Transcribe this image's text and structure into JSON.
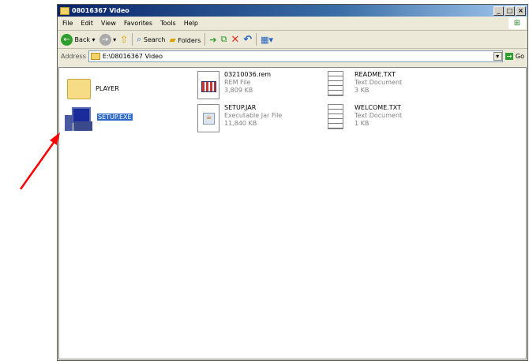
{
  "window": {
    "title": "08016367 Video",
    "controls": [
      "_",
      "□",
      "×"
    ]
  },
  "menu": [
    "File",
    "Edit",
    "View",
    "Favorites",
    "Tools",
    "Help"
  ],
  "toolbar": {
    "back": "Back",
    "search": "Search",
    "folders": "Folders"
  },
  "address": {
    "label": "Address",
    "value": "E:\\08016367 Video",
    "go": "Go"
  },
  "files": [
    {
      "name": "PLAYER"
    },
    {
      "name": "SETUP.EXE"
    },
    {
      "name": "03210036.rem",
      "type": "REM File",
      "size": "3,809 KB"
    },
    {
      "name": "SETUP.JAR",
      "type": "Executable Jar File",
      "size": "11,840 KB"
    },
    {
      "name": "README.TXT",
      "type": "Text Document",
      "size": "3 KB"
    },
    {
      "name": "WELCOME.TXT",
      "type": "Text Document",
      "size": "1 KB"
    }
  ],
  "annotation_color": "#ff0000"
}
